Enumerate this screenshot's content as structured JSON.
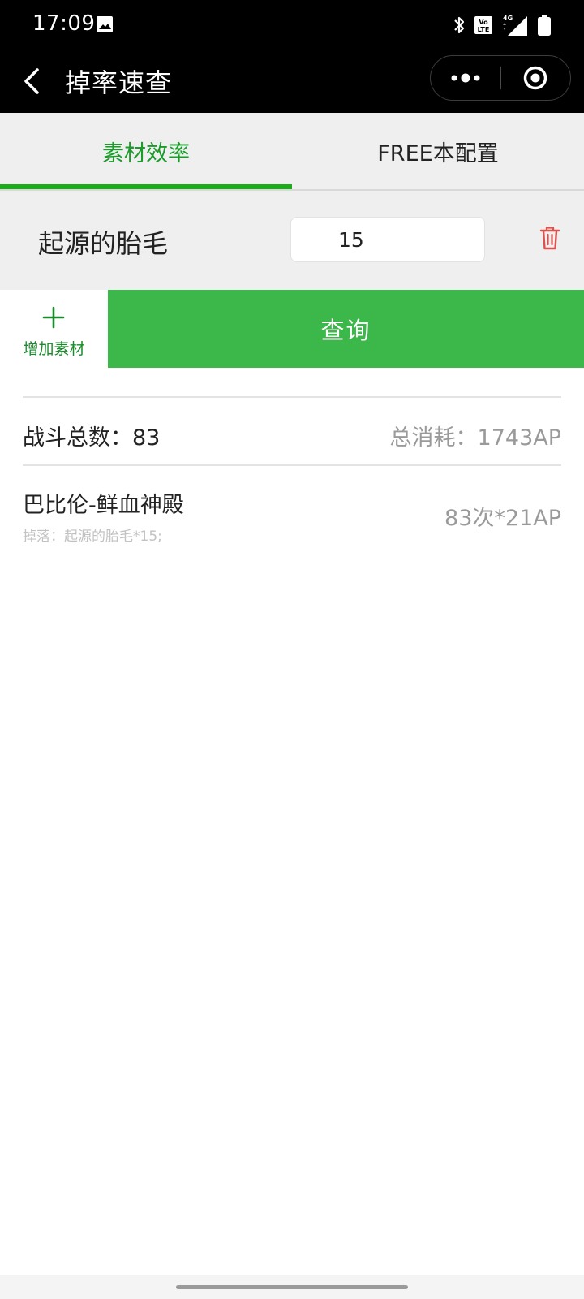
{
  "status_bar": {
    "time": "17:09",
    "icons": [
      "gallery-icon",
      "bluetooth-icon",
      "volte-icon",
      "4g-signal-icon",
      "battery-icon"
    ]
  },
  "nav": {
    "title": "掉率速查",
    "back_icon": "back-arrow-icon",
    "more_icon": "more-icon",
    "close_icon": "close-target-icon"
  },
  "tabs": [
    {
      "label": "素材效率",
      "active": true
    },
    {
      "label": "FREE本配置",
      "active": false
    }
  ],
  "material": {
    "name": "起源的胎毛",
    "quantity": "15",
    "delete_icon": "trash-icon"
  },
  "actions": {
    "add_label": "增加素材",
    "add_icon": "plus-icon",
    "query_label": "查询"
  },
  "summary": {
    "battle_count": "战斗总数：83",
    "total_cost": "总消耗：1743AP"
  },
  "results": [
    {
      "quest": "巴比伦-鲜血神殿",
      "drops": "掉落：起源的胎毛*15;",
      "runs": "83次*21AP"
    }
  ],
  "colors": {
    "accent": "#1aad19",
    "button_green": "#3cb74a",
    "delete_red": "#d9534f"
  }
}
